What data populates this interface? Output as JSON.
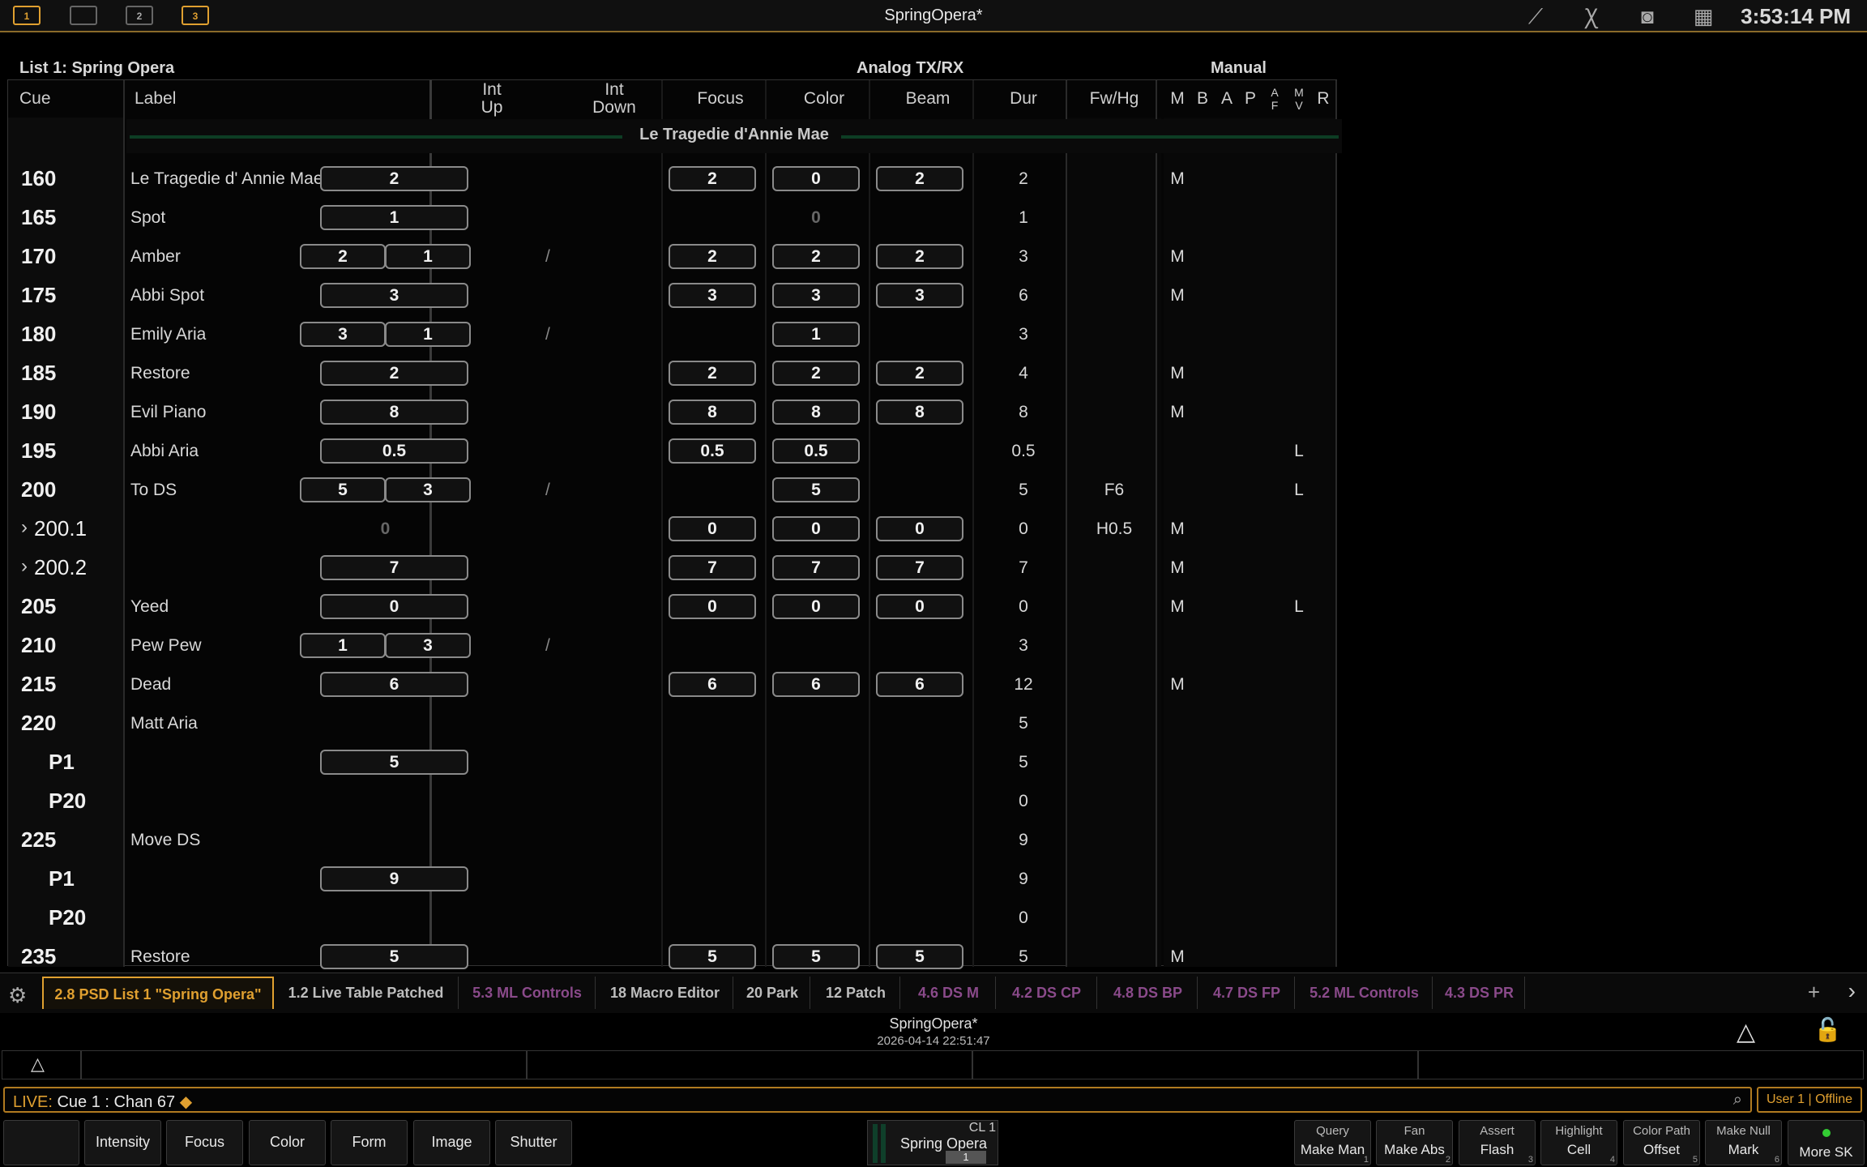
{
  "app": {
    "title": "SpringOpera*",
    "clock": "3:53:14 PM"
  },
  "workspaces": [
    "1",
    "",
    "2",
    "3"
  ],
  "list": {
    "title": "List 1: Spring Opera",
    "group_headers": {
      "analog": "Analog TX/RX",
      "manual": "Manual"
    },
    "columns": {
      "cue": "Cue",
      "label": "Label",
      "int_up": "Int\nUp",
      "int_down": "Int\nDown",
      "focus": "Focus",
      "color": "Color",
      "beam": "Beam",
      "dur": "Dur",
      "fwhg": "Fw/Hg",
      "m": "M",
      "b": "B",
      "a": "A",
      "p": "P",
      "af": "A\nF",
      "mv": "M\nV",
      "r": "R"
    },
    "scene": "Le Tragedie d'Annie Mae",
    "rows": [
      {
        "cue": "160",
        "label": "Le Tragedie d' Annie Mae",
        "int": "2",
        "focus": "2",
        "color": "0",
        "beam": "2",
        "dur": "2",
        "fw": "",
        "m": "M",
        "mv": ""
      },
      {
        "cue": "165",
        "label": "Spot",
        "int": "1",
        "focus": "",
        "color": "0",
        "color_dim": true,
        "beam": "",
        "dur": "1",
        "fw": "",
        "m": "",
        "mv": ""
      },
      {
        "cue": "170",
        "label": "Amber",
        "up": "2",
        "down": "1",
        "focus": "2",
        "color": "2",
        "beam": "2",
        "dur": "3",
        "fw": "",
        "m": "M",
        "mv": ""
      },
      {
        "cue": "175",
        "label": "Abbi Spot",
        "int": "3",
        "focus": "3",
        "color": "3",
        "beam": "3",
        "dur": "6",
        "fw": "",
        "m": "M",
        "mv": ""
      },
      {
        "cue": "180",
        "label": "Emily Aria",
        "up": "3",
        "down": "1",
        "focus": "",
        "color": "1",
        "beam": "",
        "dur": "3",
        "fw": "",
        "m": "",
        "mv": ""
      },
      {
        "cue": "185",
        "label": "Restore",
        "int": "2",
        "focus": "2",
        "color": "2",
        "beam": "2",
        "dur": "4",
        "fw": "",
        "m": "M",
        "mv": ""
      },
      {
        "cue": "190",
        "label": "Evil Piano",
        "int": "8",
        "focus": "8",
        "color": "8",
        "beam": "8",
        "dur": "8",
        "fw": "",
        "m": "M",
        "mv": ""
      },
      {
        "cue": "195",
        "label": "Abbi Aria",
        "int": "0.5",
        "focus": "0.5",
        "color": "0.5",
        "beam": "",
        "dur": "0.5",
        "fw": "",
        "m": "",
        "mv": "L"
      },
      {
        "cue": "200",
        "label": "To DS",
        "up": "5",
        "down": "3",
        "focus": "",
        "color": "5",
        "beam": "",
        "dur": "5",
        "fw": "F6",
        "m": "",
        "mv": "L"
      },
      {
        "cue": "200.1",
        "sub": true,
        "label": "",
        "int": "0",
        "int_dim": true,
        "focus": "0",
        "color": "0",
        "beam": "0",
        "dur": "0",
        "fw": "H0.5",
        "m": "M",
        "mv": ""
      },
      {
        "cue": "200.2",
        "sub": true,
        "label": "",
        "int": "7",
        "focus": "7",
        "color": "7",
        "beam": "7",
        "dur": "7",
        "fw": "",
        "m": "M",
        "mv": ""
      },
      {
        "cue": "205",
        "label": "Yeed",
        "int": "0",
        "focus": "0",
        "color": "0",
        "beam": "0",
        "dur": "0",
        "fw": "",
        "m": "M",
        "mv": "L"
      },
      {
        "cue": "210",
        "label": "Pew Pew",
        "up": "1",
        "down": "3",
        "focus": "",
        "color": "",
        "beam": "",
        "dur": "3",
        "fw": "",
        "m": "",
        "mv": ""
      },
      {
        "cue": "215",
        "label": "Dead",
        "int": "6",
        "focus": "6",
        "color": "6",
        "beam": "6",
        "dur": "12",
        "fw": "",
        "m": "M",
        "mv": ""
      },
      {
        "cue": "220",
        "label": "Matt Aria",
        "focus": "",
        "color": "",
        "beam": "",
        "dur": "5",
        "fw": "",
        "m": "",
        "mv": ""
      },
      {
        "cue": "P1",
        "part": true,
        "label": "",
        "int": "5",
        "focus": "",
        "color": "",
        "beam": "",
        "dur": "5",
        "fw": "",
        "m": "",
        "mv": ""
      },
      {
        "cue": "P20",
        "part": true,
        "label": "",
        "focus": "",
        "color": "",
        "beam": "",
        "dur": "0",
        "fw": "",
        "m": "",
        "mv": ""
      },
      {
        "cue": "225",
        "label": "Move DS",
        "focus": "",
        "color": "",
        "beam": "",
        "dur": "9",
        "fw": "",
        "m": "",
        "mv": ""
      },
      {
        "cue": "P1",
        "part": true,
        "label": "",
        "int": "9",
        "focus": "",
        "color": "",
        "beam": "",
        "dur": "9",
        "fw": "",
        "m": "",
        "mv": ""
      },
      {
        "cue": "P20",
        "part": true,
        "label": "",
        "focus": "",
        "color": "",
        "beam": "",
        "dur": "0",
        "fw": "",
        "m": "",
        "mv": ""
      },
      {
        "cue": "235",
        "label": "Restore",
        "int": "5",
        "focus": "5",
        "color": "5",
        "beam": "5",
        "dur": "5",
        "fw": "",
        "m": "M",
        "mv": ""
      }
    ]
  },
  "tabs": [
    {
      "label": "2.8 PSD List 1 \"Spring Opera\"",
      "style": "active"
    },
    {
      "label": "1.2 Live Table Patched",
      "style": ""
    },
    {
      "label": "5.3 ML Controls",
      "style": "purple"
    },
    {
      "label": "18 Macro Editor",
      "style": ""
    },
    {
      "label": "20 Park",
      "style": ""
    },
    {
      "label": "12 Patch",
      "style": ""
    },
    {
      "label": "4.6 DS  M",
      "style": "purple"
    },
    {
      "label": "4.2 DS  CP",
      "style": "purple"
    },
    {
      "label": "4.8 DS  BP",
      "style": "purple"
    },
    {
      "label": "4.7 DS  FP",
      "style": "purple"
    },
    {
      "label": "5.2 ML Controls",
      "style": "purple"
    },
    {
      "label": "4.3 DS  PR",
      "style": "purple"
    }
  ],
  "show": {
    "name": "SpringOpera*",
    "date": "2026-04-14 22:51:47"
  },
  "command_line": {
    "mode": "LIVE:",
    "text": "Cue  1 :  Chan 67",
    "user": "User 1 | Offline"
  },
  "softkeys_left": [
    "Intensity",
    "Focus",
    "Color",
    "Form",
    "Image",
    "Shutter"
  ],
  "cue_list_panel": {
    "num": "CL 1",
    "name": "Spring Opera",
    "cue": "1"
  },
  "softkeys_right": [
    {
      "top": "Query",
      "bottom": "Make Man",
      "n": "1"
    },
    {
      "top": "Fan",
      "bottom": "Make Abs",
      "n": "2"
    },
    {
      "top": "Assert",
      "bottom": "Flash",
      "n": "3"
    },
    {
      "top": "Highlight",
      "bottom": "Cell",
      "n": "4"
    },
    {
      "top": "Color Path",
      "bottom": "Offset",
      "n": "5"
    },
    {
      "top": "Make Null",
      "bottom": "Mark",
      "n": "6"
    },
    {
      "top": "",
      "bottom": "More SK",
      "n": ""
    }
  ]
}
